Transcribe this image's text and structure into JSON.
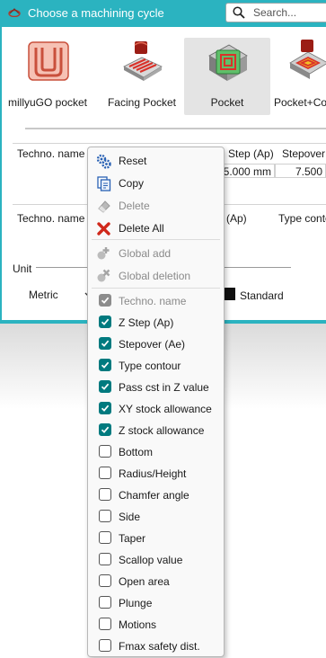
{
  "window": {
    "title": "Choose a machining cycle",
    "search_placeholder": "Search..."
  },
  "cycles": [
    {
      "label": "millyuGO pocket",
      "icon": "millyugo-pocket-icon"
    },
    {
      "label": "Facing Pocket",
      "icon": "facing-pocket-icon"
    },
    {
      "label": "Pocket",
      "icon": "pocket-icon",
      "selected": true
    },
    {
      "label": "Pocket+Con",
      "icon": "pocket-contour-icon"
    }
  ],
  "table1": {
    "headers": [
      "Techno. name",
      "Step (Ap)",
      "Stepover"
    ],
    "values": [
      "5.000 mm",
      "7.500"
    ]
  },
  "table2": {
    "headers": [
      "Techno. name",
      "(Ap)",
      "Type conto"
    ]
  },
  "unit": {
    "label": "Unit",
    "value": "Metric",
    "standard_label": "Standard"
  },
  "menu": {
    "actions": [
      {
        "label": "Reset",
        "icon": "gear-reset-icon",
        "disabled": false
      },
      {
        "label": "Copy",
        "icon": "copy-icon",
        "disabled": false
      },
      {
        "label": "Delete",
        "icon": "eraser-icon",
        "disabled": true
      },
      {
        "label": "Delete All",
        "icon": "red-x-icon",
        "disabled": false
      },
      {
        "label": "Global add",
        "icon": "global-add-icon",
        "disabled": true
      },
      {
        "label": "Global deletion",
        "icon": "global-delete-icon",
        "disabled": true
      }
    ],
    "columns": [
      {
        "label": "Techno. name",
        "checked": true,
        "disabled": true
      },
      {
        "label": "Z Step (Ap)",
        "checked": true
      },
      {
        "label": "Stepover (Ae)",
        "checked": true
      },
      {
        "label": "Type contour",
        "checked": true
      },
      {
        "label": "Pass cst in Z value",
        "checked": true
      },
      {
        "label": "XY stock allowance",
        "checked": true
      },
      {
        "label": "Z stock allowance",
        "checked": true
      },
      {
        "label": "Bottom",
        "checked": false
      },
      {
        "label": "Radius/Height",
        "checked": false
      },
      {
        "label": "Chamfer angle",
        "checked": false
      },
      {
        "label": "Side",
        "checked": false
      },
      {
        "label": "Taper",
        "checked": false
      },
      {
        "label": "Scallop value",
        "checked": false
      },
      {
        "label": "Open area",
        "checked": false
      },
      {
        "label": "Plunge",
        "checked": false
      },
      {
        "label": "Motions",
        "checked": false
      },
      {
        "label": "Fmax safety dist.",
        "checked": false
      }
    ]
  },
  "colors": {
    "accent": "#2bb3c0",
    "checkbox_on": "#007a7f"
  }
}
